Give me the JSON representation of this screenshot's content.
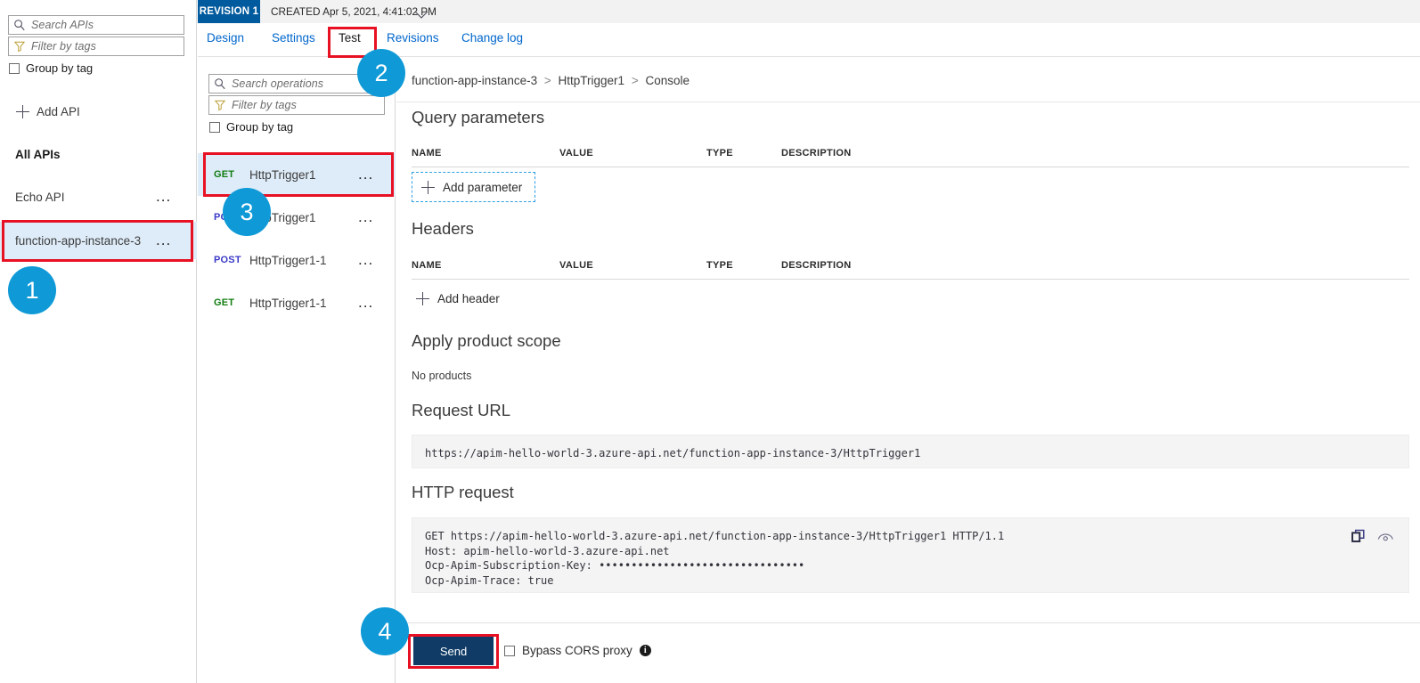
{
  "sidebar": {
    "search": {
      "placeholder": "Search APIs",
      "icon": "search-icon"
    },
    "filter": {
      "placeholder": "Filter by tags",
      "icon": "filter-icon"
    },
    "group_by_tag_label": "Group by tag",
    "add_api_label": "Add API",
    "section_label": "All APIs",
    "items": [
      {
        "label": "Echo API",
        "selected": false,
        "more": "..."
      },
      {
        "label": "function-app-instance-3",
        "selected": true,
        "more": "..."
      }
    ]
  },
  "operations_pane": {
    "search": {
      "placeholder": "Search operations",
      "icon": "search-icon"
    },
    "filter": {
      "placeholder": "Filter by tags",
      "icon": "filter-icon"
    },
    "group_by_tag_label": "Group by tag",
    "items": [
      {
        "method": "GET",
        "name": "HttpTrigger1",
        "selected": true,
        "more": "..."
      },
      {
        "method": "POST",
        "name": "HttpTrigger1",
        "selected": false,
        "more": "..."
      },
      {
        "method": "POST",
        "name": "HttpTrigger1-1",
        "selected": false,
        "more": "..."
      },
      {
        "method": "GET",
        "name": "HttpTrigger1-1",
        "selected": false,
        "more": "..."
      }
    ]
  },
  "revision_bar": {
    "badge": "REVISION 1",
    "created": "CREATED Apr 5, 2021, 4:41:02 PM"
  },
  "tabs": [
    {
      "label": "Design",
      "active": false
    },
    {
      "label": "Settings",
      "active": false
    },
    {
      "label": "Test",
      "active": true
    },
    {
      "label": "Revisions",
      "active": false
    },
    {
      "label": "Change log",
      "active": false
    }
  ],
  "breadcrumb": {
    "parts": [
      "function-app-instance-3",
      "HttpTrigger1",
      "Console"
    ],
    "separator": ">"
  },
  "query_parameters": {
    "title": "Query parameters",
    "columns": [
      "NAME",
      "VALUE",
      "TYPE",
      "DESCRIPTION"
    ],
    "rows": [],
    "add_label": "Add parameter"
  },
  "headers": {
    "title": "Headers",
    "columns": [
      "NAME",
      "VALUE",
      "TYPE",
      "DESCRIPTION"
    ],
    "rows": [],
    "add_label": "Add header"
  },
  "product_scope": {
    "title": "Apply product scope",
    "value": "No products"
  },
  "request_url": {
    "title": "Request URL",
    "value": "https://apim-hello-world-3.azure-api.net/function-app-instance-3/HttpTrigger1"
  },
  "http_request": {
    "title": "HTTP request",
    "value": "GET https://apim-hello-world-3.azure-api.net/function-app-instance-3/HttpTrigger1 HTTP/1.1\nHost: apim-hello-world-3.azure-api.net\nOcp-Apim-Subscription-Key: ••••••••••••••••••••••••••••••••\nOcp-Apim-Trace: true",
    "copy_icon": "copy-icon",
    "eye_icon": "eye-icon"
  },
  "footer": {
    "send_label": "Send",
    "bypass_cors_label": "Bypass CORS proxy",
    "info_glyph": "i"
  },
  "annotations": {
    "steps": [
      "1",
      "2",
      "3",
      "4"
    ],
    "highlight_color": "#e81123",
    "step_color": "#0f9ad7"
  }
}
